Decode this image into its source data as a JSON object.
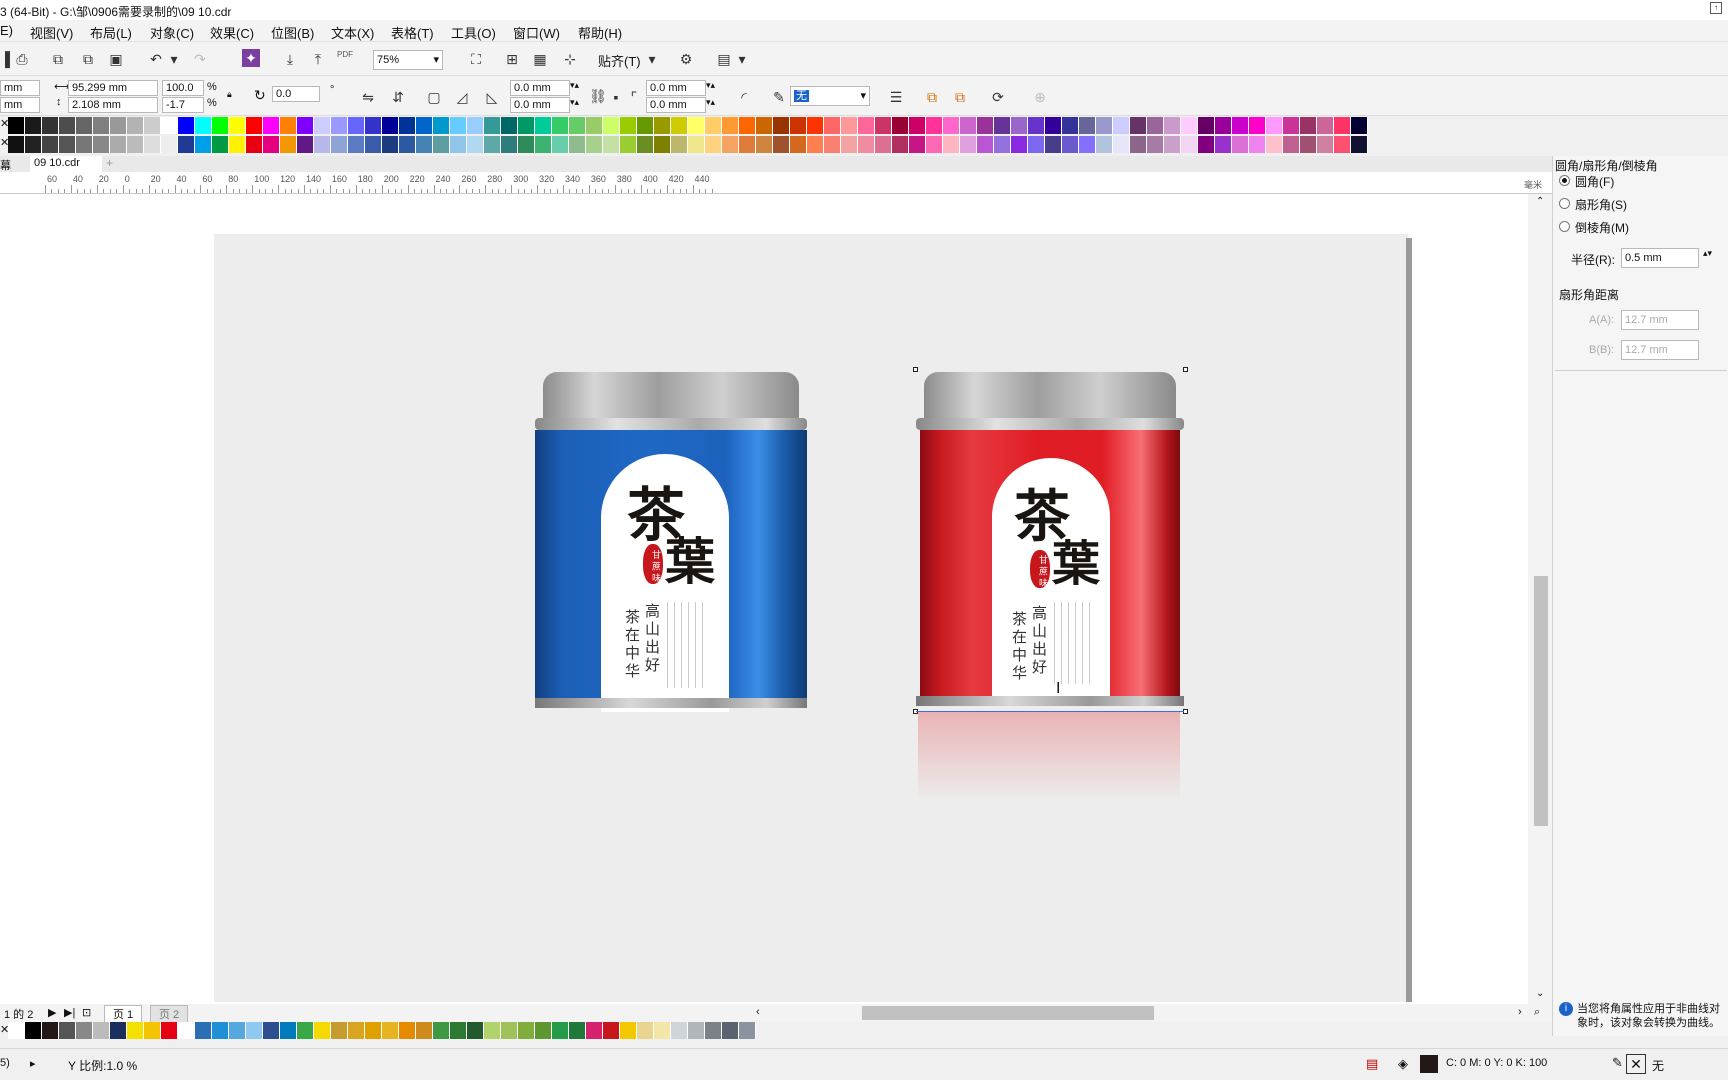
{
  "window": {
    "title": "3 (64-Bit) - G:\\邹\\0906需要录制的\\09 10.cdr"
  },
  "menu": [
    "E)",
    "视图(V)",
    "布局(L)",
    "对象(C)",
    "效果(C)",
    "位图(B)",
    "文本(X)",
    "表格(T)",
    "工具(O)",
    "窗口(W)",
    "帮助(H)"
  ],
  "toolbar": {
    "zoom_value": "75%",
    "snap_label": "贴齐(T)",
    "pdf_label": "PDF"
  },
  "property_bar": {
    "x_unit": "mm",
    "y_unit": "mm",
    "width": "95.299 mm",
    "height": "2.108 mm",
    "scale_x": "100.0",
    "scale_y": "-1.7",
    "percent": "%",
    "rotation": "0.0",
    "corner_tl": "0.0 mm",
    "corner_bl": "0.0 mm",
    "corner_tr": "0.0 mm",
    "corner_br": "0.0 mm",
    "outline": "无"
  },
  "doc_tabs": {
    "left_tab": "幕",
    "active_tab": "09 10.cdr"
  },
  "ruler": {
    "labels": [
      "60",
      "40",
      "20",
      "0",
      "20",
      "40",
      "60",
      "80",
      "100",
      "120",
      "140",
      "160",
      "180",
      "200",
      "220",
      "240",
      "260",
      "280",
      "300",
      "320",
      "340",
      "360",
      "380",
      "400",
      "420",
      "440"
    ],
    "unit": "毫米"
  },
  "cans": {
    "big_char_1": "茶",
    "big_char_2": "葉",
    "seal_text": "甘 蔗 味",
    "columns": [
      "高山出好",
      "茶在中华"
    ]
  },
  "docker": {
    "title": "圆角/扇形角/倒棱角",
    "options": [
      "圆角(F)",
      "扇形角(S)",
      "倒棱角(M)"
    ],
    "selected": "圆角(F)",
    "radius_label": "半径(R):",
    "radius_value": "0.5 mm",
    "fan_title": "扇形角距离",
    "a_label": "A(A):",
    "a_value": "12.7 mm",
    "b_label": "B(B):",
    "b_value": "12.7 mm",
    "info": "当您将角属性应用于非曲线对象时，该对象会转换为曲线。"
  },
  "pagebar": {
    "page_of": "1 的 2",
    "page1": "页 1",
    "page2": "页 2"
  },
  "status": {
    "left": "5)",
    "y_scale": "Y 比例:1.0 %",
    "fill_info": "C: 0 M: 0 Y: 0 K: 100",
    "outline_info": "无"
  },
  "colors": {
    "blue_can": "#1b5fb3",
    "red_can": "#e01c24",
    "lid": "#a9a9a9",
    "page": "#ededed"
  }
}
